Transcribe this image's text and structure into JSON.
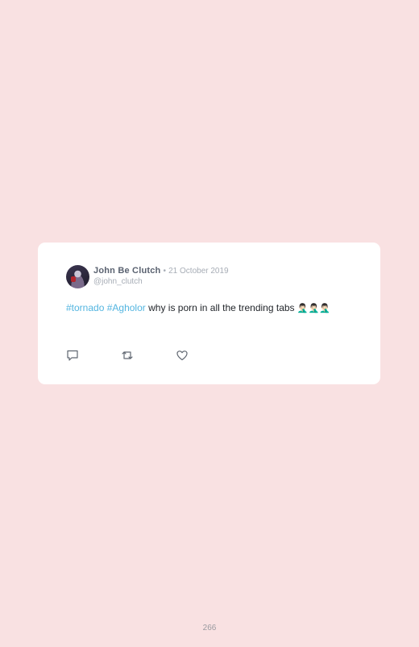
{
  "tweet": {
    "author_name": "John Be Clutch",
    "separator": "•",
    "date": "21 October 2019",
    "handle": "@john_clutch",
    "hashtags": [
      "#tornado",
      "#Agholor"
    ],
    "text": "why is porn in all the trending tabs",
    "emojis": "🤦🏻‍♂️🤦🏻‍♂️🤦🏻‍♂️"
  },
  "actions": [
    "reply-icon",
    "retweet-icon",
    "like-icon"
  ],
  "colors": {
    "background": "#f9e1e2",
    "card": "#ffffff",
    "hashtag": "#53b5e0",
    "muted": "#a7adb6"
  },
  "page_number": "266"
}
